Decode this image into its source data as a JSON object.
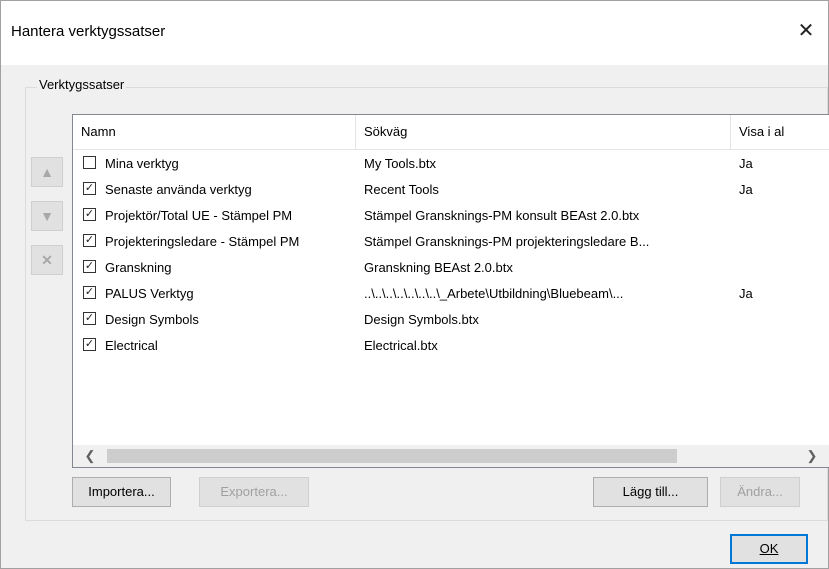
{
  "window": {
    "title": "Hantera verktygssatser"
  },
  "group": {
    "label": "Verktygssatser"
  },
  "columns": {
    "name": "Namn",
    "path": "Sökväg",
    "show": "Visa i al"
  },
  "rows": [
    {
      "checked": false,
      "name": "Mina verktyg",
      "path": "My Tools.btx",
      "show": "Ja"
    },
    {
      "checked": true,
      "name": "Senaste använda verktyg",
      "path": "Recent Tools",
      "show": "Ja"
    },
    {
      "checked": true,
      "name": "Projektör/Total UE - Stämpel PM",
      "path": "Stämpel Gransknings-PM konsult BEAst 2.0.btx",
      "show": ""
    },
    {
      "checked": true,
      "name": "Projekteringsledare - Stämpel PM",
      "path": "Stämpel Gransknings-PM projekteringsledare B...",
      "show": ""
    },
    {
      "checked": true,
      "name": "Granskning",
      "path": "Granskning BEAst 2.0.btx",
      "show": ""
    },
    {
      "checked": true,
      "name": "PALUS Verktyg",
      "path": "..\\..\\..\\..\\..\\..\\..\\_Arbete\\Utbildning\\Bluebeam\\...",
      "show": "Ja"
    },
    {
      "checked": true,
      "name": "Design Symbols",
      "path": "Design Symbols.btx",
      "show": ""
    },
    {
      "checked": true,
      "name": "Electrical",
      "path": "Electrical.btx",
      "show": ""
    }
  ],
  "side_buttons": {
    "up": "▲",
    "down": "▼",
    "remove": "✕"
  },
  "buttons": {
    "import": "Importera...",
    "export": "Exportera...",
    "add": "Lägg till...",
    "edit": "Ändra...",
    "ok": "OK"
  }
}
